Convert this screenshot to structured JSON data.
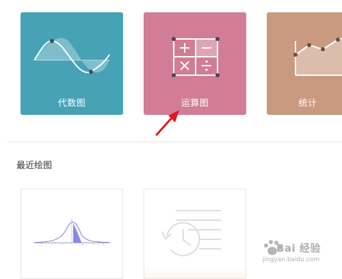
{
  "colors": {
    "algebra_tile": "#47a2b6",
    "operation_tile": "#d17d97",
    "stats_tile": "#c99a7f",
    "arrow": "#e0181b",
    "highlight": "#8888ee"
  },
  "tiles": [
    {
      "label": "代数图",
      "icon": "sine-wave-icon"
    },
    {
      "label": "运算图",
      "icon": "calculator-grid-icon"
    },
    {
      "label": "统计",
      "icon": "line-chart-icon"
    }
  ],
  "recent": {
    "title": "最近绘图",
    "items": [
      {
        "icon": "normal-distribution-thumbnail"
      },
      {
        "icon": "history-clock-icon"
      }
    ]
  },
  "watermark": {
    "brand": "Bai 经验",
    "url": "jingyan.baidu.com"
  }
}
